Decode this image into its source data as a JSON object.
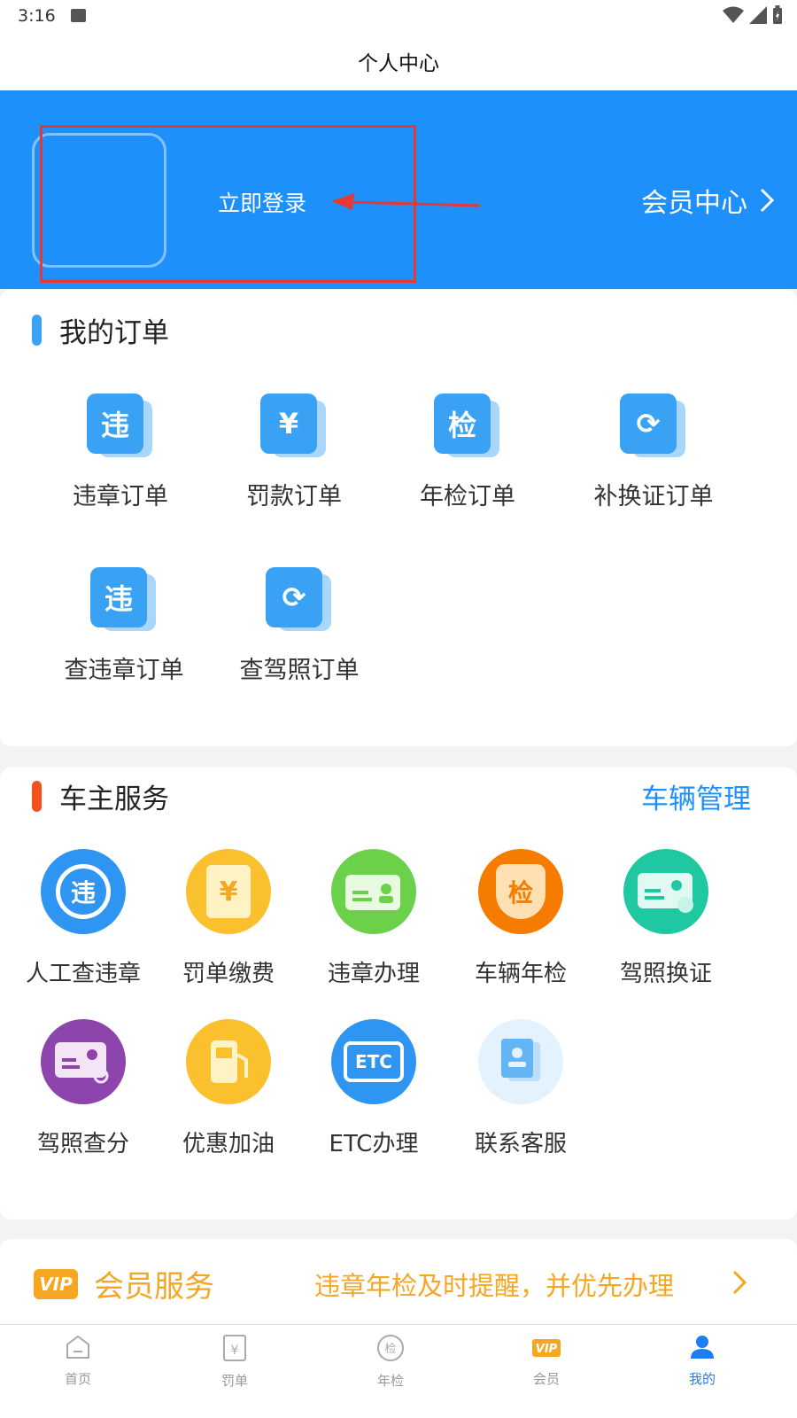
{
  "status": {
    "time": "3:16"
  },
  "title": "个人中心",
  "hero": {
    "login_text": "立即登录",
    "member_center": "会员中心"
  },
  "orders": {
    "title": "我的订单",
    "items": [
      {
        "label": "违章订单",
        "icon": "violation-icon",
        "glyph": "违"
      },
      {
        "label": "罚款订单",
        "icon": "yen-icon",
        "glyph": "¥"
      },
      {
        "label": "年检订单",
        "icon": "inspection-icon",
        "glyph": "检"
      },
      {
        "label": "补换证订单",
        "icon": "refresh-icon",
        "glyph": "⟳"
      },
      {
        "label": "查违章订单",
        "icon": "violation-icon",
        "glyph": "违"
      },
      {
        "label": "查驾照订单",
        "icon": "refresh-icon",
        "glyph": "⟳"
      }
    ]
  },
  "services": {
    "title": "车主服务",
    "manage_link": "车辆管理",
    "items": [
      {
        "label": "人工查违章",
        "icon": "violation-search-icon",
        "color": "#2f95f2",
        "glyph": "违"
      },
      {
        "label": "罚单缴费",
        "icon": "fine-payment-icon",
        "color": "#fbc02d",
        "glyph": "¥"
      },
      {
        "label": "违章办理",
        "icon": "id-card-icon",
        "color": "#6bd04a",
        "glyph": ""
      },
      {
        "label": "车辆年检",
        "icon": "shield-inspection-icon",
        "color": "#f57c00",
        "glyph": "检"
      },
      {
        "label": "驾照换证",
        "icon": "license-renew-icon",
        "color": "#1fc8a0",
        "glyph": ""
      },
      {
        "label": "驾照查分",
        "icon": "license-points-icon",
        "color": "#8e44ad",
        "glyph": ""
      },
      {
        "label": "优惠加油",
        "icon": "fuel-pump-icon",
        "color": "#fbc02d",
        "glyph": "⛽"
      },
      {
        "label": "ETC办理",
        "icon": "etc-icon",
        "color": "#2f95f2",
        "glyph": "ETC"
      },
      {
        "label": "联系客服",
        "icon": "customer-service-icon",
        "color": "#e3f2fd",
        "glyph": ""
      }
    ]
  },
  "vip": {
    "badge": "VIP",
    "title": "会员服务",
    "desc": "违章年检及时提醒，并优先办理"
  },
  "tabs": [
    {
      "label": "首页",
      "icon": "home-icon"
    },
    {
      "label": "罚单",
      "icon": "ticket-icon"
    },
    {
      "label": "年检",
      "icon": "inspection-icon"
    },
    {
      "label": "会员",
      "icon": "vip-icon"
    },
    {
      "label": "我的",
      "icon": "profile-icon"
    }
  ],
  "colors": {
    "primary": "#1e90fb",
    "accent_orange": "#f5a623",
    "orders_bar": "#3aa2f5",
    "services_bar": "#f4511e",
    "highlight": "#e53935"
  }
}
